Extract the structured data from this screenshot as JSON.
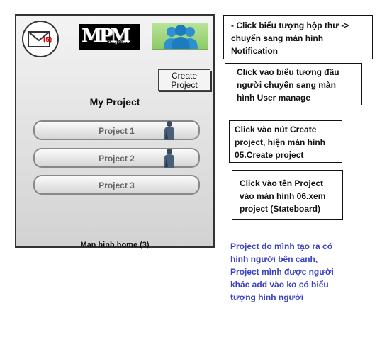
{
  "phone": {
    "mail_count": "(5)",
    "logo_text": "MPM",
    "logo_subtext": "anagement",
    "create_button_label": "Create\nProject",
    "page_title": "My Project",
    "projects": [
      {
        "label": "Project 1",
        "has_person": true
      },
      {
        "label": "Project 2",
        "has_person": true
      },
      {
        "label": "Project 3",
        "has_person": false
      }
    ],
    "screen_caption": "Man hinh home (3)"
  },
  "notes": {
    "mail_note": "- Click biểu tượng hộp thư -> chuyển sang màn hình Notification",
    "users_note": "Click vao biểu tượng đầu người chuyển sang màn hình User manage",
    "create_note": "Click vào nút Create project, hiện màn hình 05.Create project",
    "project_note": "Click vào tên Project vào màn hình 06.xem project (Stateboard)",
    "owner_note": "Project do mình tạo ra có hình người bên cạnh, Project mình được người khác add vào ko có biểu tượng hình người"
  },
  "colors": {
    "accent_blue": "#3b43c4",
    "mail_count": "#dd0000",
    "users_button": "#8ccb66"
  }
}
